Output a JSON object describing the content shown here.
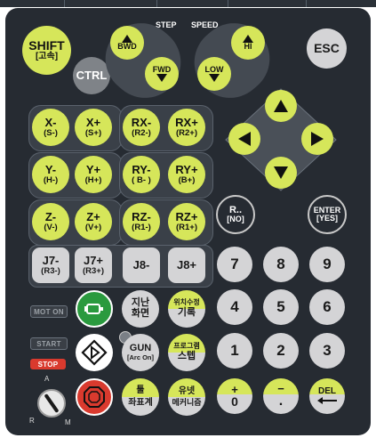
{
  "top_labels": {
    "step": "STEP",
    "speed": "SPEED"
  },
  "buttons": {
    "shift": {
      "main": "SHIFT",
      "sub": "[고속]"
    },
    "ctrl": "CTRL",
    "esc": "ESC",
    "bwd": "BWD",
    "fwd": "FWD",
    "low": "LOW",
    "hi": "HI",
    "axes": [
      {
        "main": "X-",
        "sub": "(S-)"
      },
      {
        "main": "X+",
        "sub": "(S+)"
      },
      {
        "main": "RX-",
        "sub": "(R2-)"
      },
      {
        "main": "RX+",
        "sub": "(R2+)"
      },
      {
        "main": "Y-",
        "sub": "(H-)"
      },
      {
        "main": "Y+",
        "sub": "(H+)"
      },
      {
        "main": "RY-",
        "sub": "( B- )"
      },
      {
        "main": "RY+",
        "sub": "(B+)"
      },
      {
        "main": "Z-",
        "sub": "(V-)"
      },
      {
        "main": "Z+",
        "sub": "(V+)"
      },
      {
        "main": "RZ-",
        "sub": "(R1-)"
      },
      {
        "main": "RZ+",
        "sub": "(R1+)"
      }
    ],
    "r_no": {
      "main": "R..",
      "sub": "[NO]"
    },
    "enter_yes": {
      "main": "ENTER",
      "sub": "[YES]"
    },
    "j7m": {
      "main": "J7-",
      "sub": "(R3-)"
    },
    "j7p": {
      "main": "J7+",
      "sub": "(R3+)"
    },
    "j8m": "J8-",
    "j8p": "J8+",
    "digits": [
      "7",
      "8",
      "9",
      "4",
      "5",
      "6",
      "1",
      "2",
      "3"
    ],
    "prev_screen": {
      "l1": "지난",
      "l2": "화면"
    },
    "pos_edit": {
      "l1": "위치수정",
      "l2": "기록"
    },
    "gun": {
      "l1": "GUN",
      "l2": "[Arc On]"
    },
    "program": {
      "l1": "프로그램",
      "l2": "스텝"
    },
    "tool": {
      "l1": "툴",
      "l2": "좌표계"
    },
    "utility": {
      "l1": "유넷",
      "l2": "메커니즘"
    },
    "plus_zero": {
      "l1": "+",
      "l2": "0"
    },
    "minus_dot": {
      "l1": "−",
      "l2": "."
    },
    "del": "DEL"
  },
  "indicators": {
    "mot_on": "MOT ON",
    "start": "START",
    "stop": "STOP"
  },
  "mode_switch": {
    "a": "A",
    "r": "R",
    "m": "M"
  },
  "colors": {
    "accent": "#d6e65a",
    "panel": "#262b32",
    "gray_key": "#d4d4d6",
    "green": "#2a9a3e",
    "red": "#d93a2e"
  }
}
